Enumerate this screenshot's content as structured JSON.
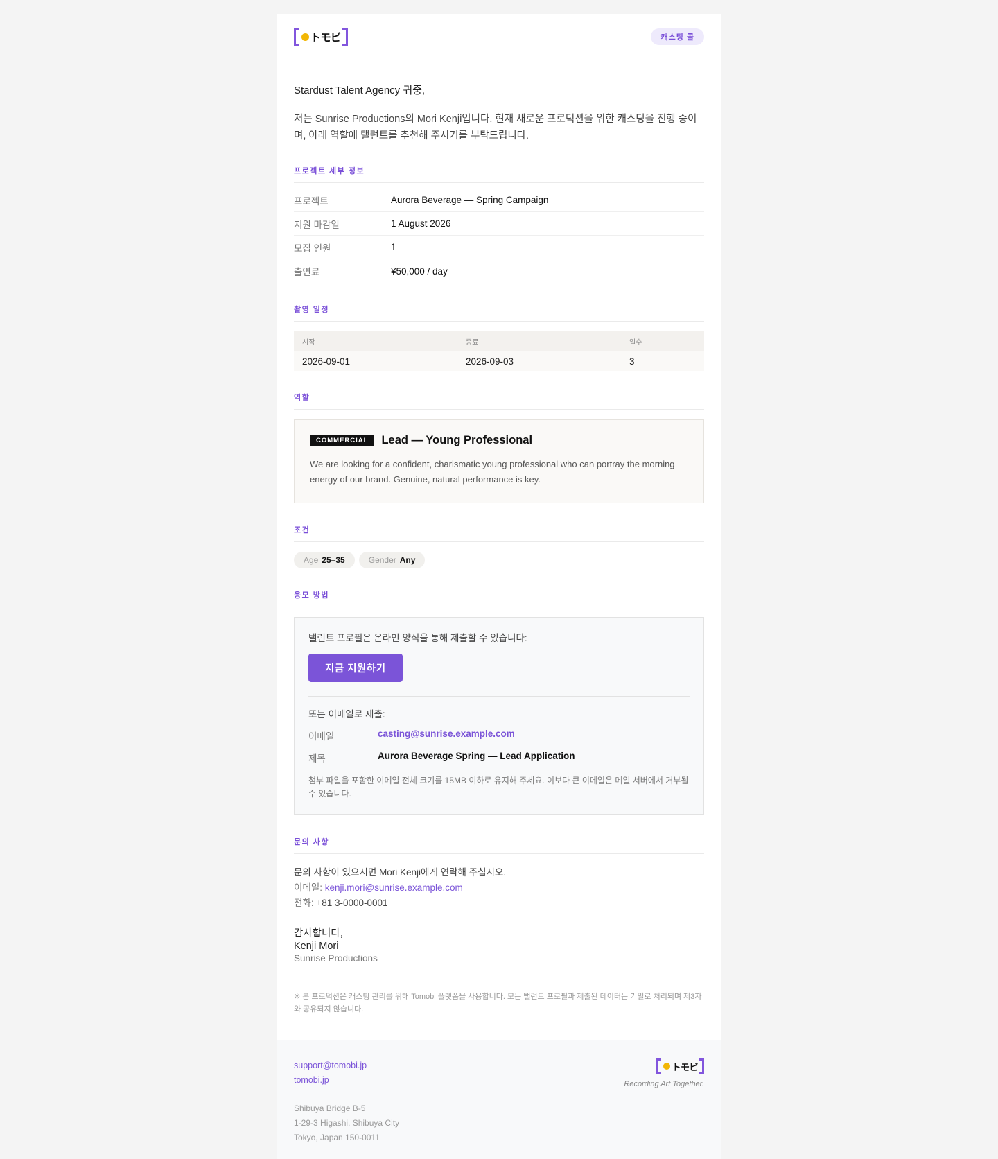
{
  "brand": {
    "logo_text": "トモビ",
    "accent": "#7b54d8",
    "dot_color": "#f2b705"
  },
  "header": {
    "tag": "캐스팅 콜"
  },
  "greeting": "Stardust Talent Agency 귀중,",
  "intro": "저는 Sunrise Productions의 Mori Kenji입니다. 현재 새로운 프로덕션을 위한 캐스팅을 진행 중이며, 아래 역할에 탤런트를 추천해 주시기를 부탁드립니다.",
  "details": {
    "title": "프로젝트 세부 정보",
    "rows": [
      {
        "label": "프로젝트",
        "value": "Aurora Beverage — Spring Campaign"
      },
      {
        "label": "지원 마감일",
        "value": "1 August 2026"
      },
      {
        "label": "모집 인원",
        "value": "1"
      },
      {
        "label": "출연료",
        "value": "¥50,000 / day"
      }
    ]
  },
  "schedule": {
    "title": "촬영 일정",
    "headers": [
      "시작",
      "종료",
      "일수"
    ],
    "row": [
      "2026-09-01",
      "2026-09-03",
      "3"
    ]
  },
  "role": {
    "title": "역할",
    "badge": "COMMERCIAL",
    "name": "Lead — Young Professional",
    "description": "We are looking for a confident, charismatic young professional who can portray the morning energy of our brand. Genuine, natural performance is key."
  },
  "requirements": {
    "title": "조건",
    "chips": [
      {
        "label": "Age",
        "value": "25–35"
      },
      {
        "label": "Gender",
        "value": "Any"
      }
    ]
  },
  "apply": {
    "title": "응모 방법",
    "text": "탤런트 프로필은 온라인 양식을 통해 제출할 수 있습니다:",
    "button": "지금 지원하기",
    "email_intro": "또는 이메일로 제출:",
    "email_label": "이메일",
    "email_value": "casting@sunrise.example.com",
    "subject_label": "제목",
    "subject_value": "Aurora Beverage Spring — Lead Application",
    "note": "첨부 파일을 포함한 이메일 전체 크기를 15MB 이하로 유지해 주세요. 이보다 큰 이메일은 메일 서버에서 거부될 수 있습니다."
  },
  "contact": {
    "title": "문의 사항",
    "line1": "문의 사항이 있으시면 Mori Kenji에게 연락해 주십시오.",
    "email_label": "이메일:",
    "email": "kenji.mori@sunrise.example.com",
    "phone_label": "전화:",
    "phone": "+81 3-0000-0001"
  },
  "closing": {
    "thanks": "감사합니다,",
    "name": "Kenji Mori",
    "company": "Sunrise Productions"
  },
  "disclaimer": "※ 본 프로덕션은 캐스팅 관리를 위해 Tomobi 플랫폼을 사용합니다. 모든 탤런트 프로필과 제출된 데이터는 기밀로 처리되며 제3자와 공유되지 않습니다.",
  "footer": {
    "support": "support@tomobi.jp",
    "site": "tomobi.jp",
    "address": [
      "Shibuya Bridge B-5",
      "1-29-3 Higashi, Shibuya City",
      "Tokyo, Japan 150-0011"
    ],
    "tagline": "Recording Art Together."
  }
}
